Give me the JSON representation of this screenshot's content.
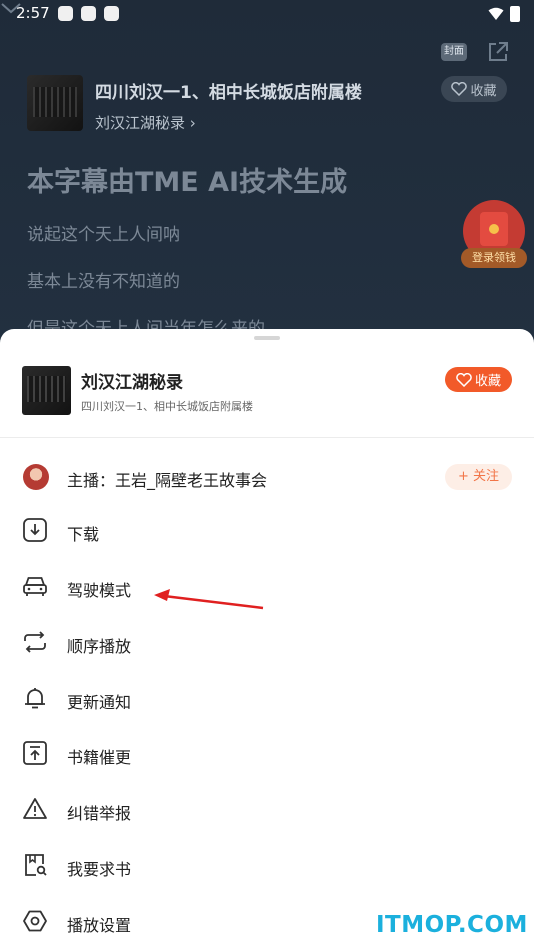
{
  "status_bar": {
    "time": "2:57"
  },
  "player": {
    "cover_button_label": "封面",
    "episode_title": "四川刘汉一1、相中长城饭店附属楼",
    "album_link": "刘汉江湖秘录",
    "favorite_label": "收藏",
    "subtitle_note": "本字幕由TME AI技术生成",
    "lyrics": [
      "说起这个天上人间呐",
      "基本上没有不知道的",
      "但是这个天上人间当年怎么来的"
    ],
    "redpacket_label": "登录领钱"
  },
  "sheet": {
    "album_title": "刘汉江湖秘录",
    "episode_subtitle": "四川刘汉一1、相中长城饭店附属楼",
    "favorite_label": "收藏",
    "host_label": "主播：王岩_隔壁老王故事会",
    "follow_label": "+ 关注",
    "menu": [
      {
        "label": "下载",
        "icon": "download-icon"
      },
      {
        "label": "驾驶模式",
        "icon": "car-icon"
      },
      {
        "label": "顺序播放",
        "icon": "repeat-icon"
      },
      {
        "label": "更新通知",
        "icon": "bell-icon"
      },
      {
        "label": "书籍催更",
        "icon": "urge-update-icon"
      },
      {
        "label": "纠错举报",
        "icon": "warning-icon"
      },
      {
        "label": "我要求书",
        "icon": "book-search-icon"
      },
      {
        "label": "播放设置",
        "icon": "settings-hexagon-icon"
      }
    ]
  },
  "watermark": "ITMOP.COM",
  "colors": {
    "accent": "#f25a29",
    "player_bg": "#1f2b39",
    "watermark": "#1bb0dd"
  }
}
